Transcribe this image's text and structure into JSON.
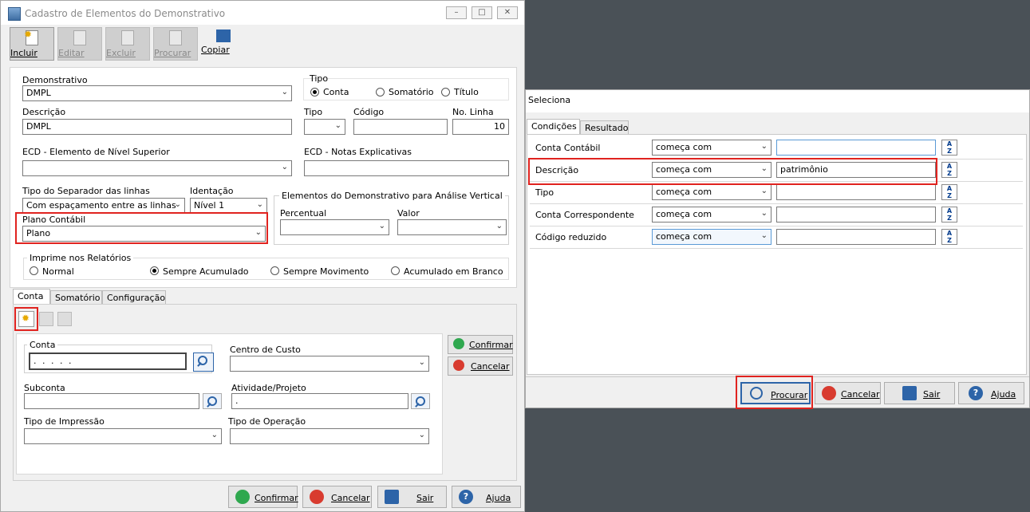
{
  "main_window": {
    "title": "Cadastro de Elementos do Demonstrativo",
    "toolbar": {
      "incluir": "Incluir",
      "editar": "Editar",
      "excluir": "Excluir",
      "procurar": "Procurar",
      "copiar": "Copiar"
    },
    "form": {
      "demonstrativo_label": "Demonstrativo",
      "demonstrativo_value": "DMPL",
      "tipo_group_label": "Tipo",
      "tipo_options": [
        "Conta",
        "Somatório",
        "Título"
      ],
      "tipo_selected": "Conta",
      "descricao_label": "Descrição",
      "descricao_value": "DMPL",
      "tipo_label": "Tipo",
      "tipo_value": "",
      "codigo_label": "Código",
      "codigo_value": "",
      "no_linha_label": "No. Linha",
      "no_linha_value": "10",
      "ecd_superior_label": "ECD - Elemento de Nível Superior",
      "ecd_superior_value": "",
      "ecd_notas_label": "ECD - Notas Explicativas",
      "ecd_notas_value": "",
      "tipo_separador_label": "Tipo do Separador das linhas",
      "tipo_separador_value": "Com espaçamento entre as linhas",
      "identacao_label": "Identação",
      "identacao_value": "Nível 1",
      "plano_contabil_label": "Plano Contábil",
      "plano_contabil_value": "Plano",
      "analise_vertical_label": "Elementos do Demonstrativo para Análise Vertical",
      "percentual_label": "Percentual",
      "percentual_value": "",
      "valor_label": "Valor",
      "valor_value": "",
      "imprime_label": "Imprime nos Relatórios",
      "imprime_options": [
        "Normal",
        "Sempre Acumulado",
        "Sempre Movimento",
        "Acumulado em Branco"
      ],
      "imprime_selected": "Sempre Acumulado"
    },
    "tabs": [
      "Conta",
      "Somatório",
      "Configuração"
    ],
    "conta_tab": {
      "conta_label": "Conta",
      "conta_value": ". . . . .",
      "centro_custo_label": "Centro de Custo",
      "centro_custo_value": "",
      "subconta_label": "Subconta",
      "subconta_value": "",
      "atividade_label": "Atividade/Projeto",
      "atividade_value": ".",
      "tipo_impressao_label": "Tipo de Impressão",
      "tipo_impressao_value": "",
      "tipo_operacao_label": "Tipo de Operação",
      "tipo_operacao_value": "",
      "confirmar": "Confirmar",
      "cancelar": "Cancelar"
    },
    "footer": {
      "confirmar": "Confirmar",
      "cancelar": "Cancelar",
      "sair": "Sair",
      "ajuda": "Ajuda"
    }
  },
  "seleciona_window": {
    "title": "Seleciona",
    "tabs": [
      "Condições",
      "Resultado"
    ],
    "rows": [
      {
        "field": "Conta Contábil",
        "operator": "começa com",
        "value": ""
      },
      {
        "field": "Descrição",
        "operator": "começa com",
        "value": "patrimônio"
      },
      {
        "field": "Tipo",
        "operator": "começa com",
        "value": ""
      },
      {
        "field": "Conta Correspondente",
        "operator": "começa com",
        "value": ""
      },
      {
        "field": "Código reduzido",
        "operator": "começa com",
        "value": ""
      }
    ],
    "footer": {
      "procurar": "Procurar",
      "cancelar": "Cancelar",
      "sair": "Sair",
      "ajuda": "Ajuda"
    }
  },
  "colors": {
    "highlight": "#e0231f",
    "confirm_green": "#2fa84f",
    "cancel_red": "#d83b2f",
    "help_blue": "#2d64a8"
  }
}
